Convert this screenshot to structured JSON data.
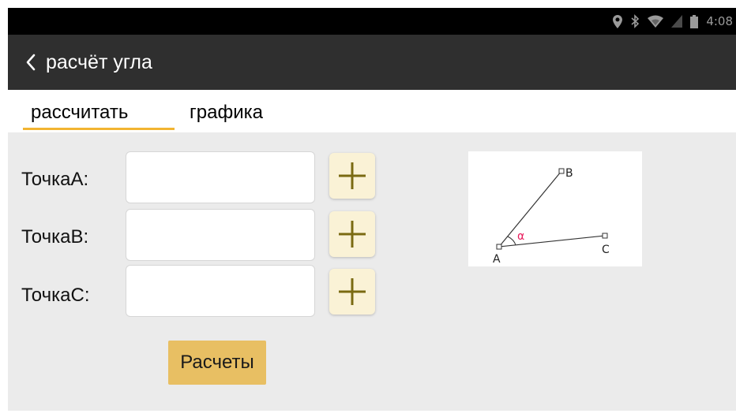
{
  "status_bar": {
    "time": "4:08",
    "icons": [
      "location-icon",
      "bluetooth-icon",
      "wifi-icon",
      "signal-icon",
      "battery-icon"
    ]
  },
  "app_bar": {
    "back_icon": "chevron-left-icon",
    "title": "расчёт угла"
  },
  "tabs": [
    {
      "label": "рассчитать",
      "active": true
    },
    {
      "label": "графика",
      "active": false
    }
  ],
  "form": {
    "fields": [
      {
        "label": "ТочкаA:",
        "value": "",
        "add_icon": "plus-icon"
      },
      {
        "label": "ТочкаB:",
        "value": "",
        "add_icon": "plus-icon"
      },
      {
        "label": "ТочкаC:",
        "value": "",
        "add_icon": "plus-icon"
      }
    ],
    "calculate_label": "Расчеты"
  },
  "diagram": {
    "points": [
      "A",
      "B",
      "C"
    ],
    "angle_symbol": "α"
  },
  "colors": {
    "app_bar": "#2f2f2f",
    "tab_indicator": "#f2b431",
    "plus_button_bg": "#faf2d6",
    "plus_icon": "#7a6a12",
    "calculate_button": "#e8bf63",
    "angle_symbol": "#e8195a"
  }
}
